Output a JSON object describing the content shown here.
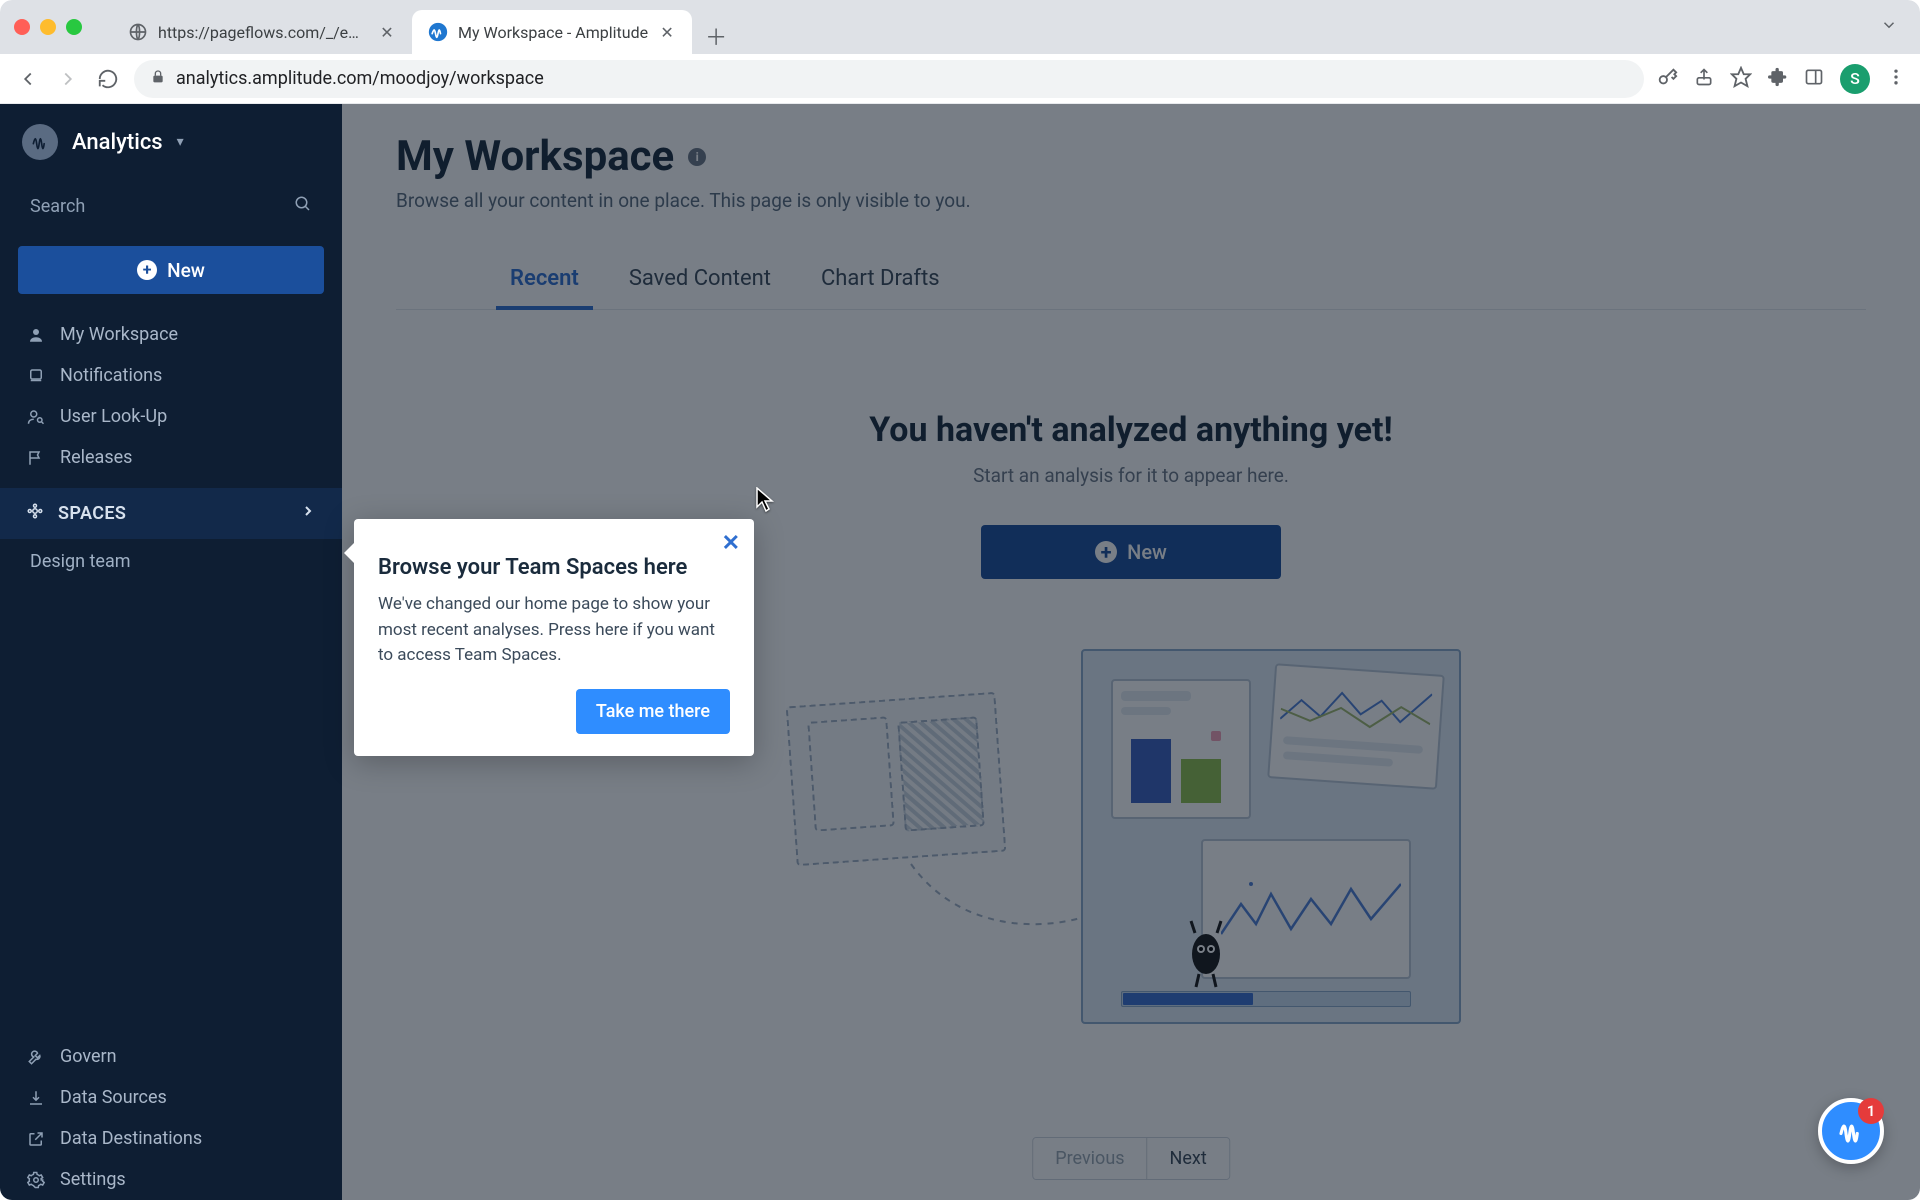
{
  "browser": {
    "tabs": [
      {
        "title": "https://pageflows.com/_/emails",
        "active": false
      },
      {
        "title": "My Workspace - Amplitude",
        "active": true
      }
    ],
    "url": "analytics.amplitude.com/moodjoy/workspace",
    "avatar_initial": "S"
  },
  "sidebar": {
    "product": "Analytics",
    "search_placeholder": "Search",
    "new_label": "New",
    "items": [
      {
        "label": "My Workspace"
      },
      {
        "label": "Notifications"
      },
      {
        "label": "User Look-Up"
      },
      {
        "label": "Releases"
      }
    ],
    "section_label": "SPACES",
    "spaces": [
      {
        "label": "Design team"
      }
    ],
    "footer": [
      {
        "label": "Govern"
      },
      {
        "label": "Data Sources"
      },
      {
        "label": "Data Destinations"
      },
      {
        "label": "Settings"
      }
    ]
  },
  "page": {
    "title": "My Workspace",
    "subtitle": "Browse all your content in one place. This page is only visible to you.",
    "tabs": [
      "Recent",
      "Saved Content",
      "Chart Drafts"
    ],
    "active_tab": "Recent",
    "empty_heading": "You haven't analyzed anything yet!",
    "empty_sub": "Start an analysis for it to appear here.",
    "empty_cta": "New",
    "pager_prev": "Previous",
    "pager_next": "Next"
  },
  "popover": {
    "title": "Browse your Team Spaces here",
    "body": "We've changed our home page to show your most recent analyses. Press here if you want to access Team Spaces.",
    "cta": "Take me there",
    "close": "✕"
  },
  "fab": {
    "badge": "1"
  }
}
